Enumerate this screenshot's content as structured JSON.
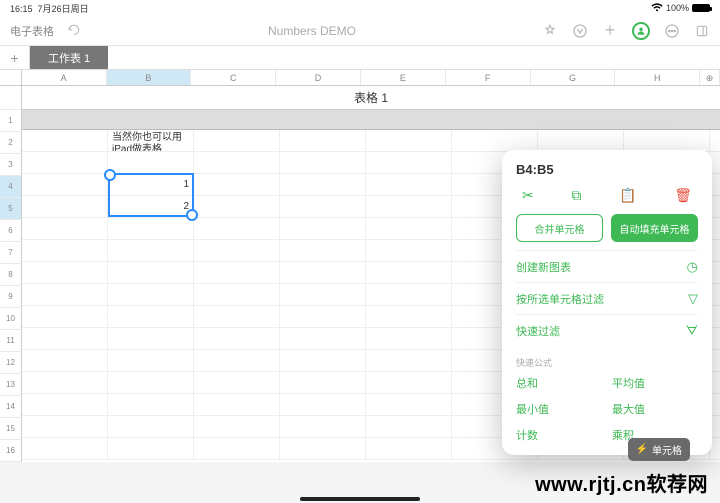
{
  "status": {
    "time": "16:15",
    "date": "7月26日周日",
    "battery": "100%"
  },
  "toolbar": {
    "back": "电子表格",
    "title": "Numbers DEMO"
  },
  "tabs": {
    "sheet1": "工作表 1"
  },
  "columns": [
    "A",
    "B",
    "C",
    "D",
    "E",
    "F",
    "G",
    "H"
  ],
  "table": {
    "title": "表格 1",
    "b2": "当然你也可以用\niPad做表格",
    "b4": "1",
    "b5": "2"
  },
  "popover": {
    "ref": "B4:B5",
    "merge": "合并单元格",
    "autofill": "自动填充单元格",
    "newchart": "创建新图表",
    "filtersel": "按所选单元格过滤",
    "quickfilter": "快速过滤",
    "section": "快速公式",
    "sum": "总和",
    "avg": "平均值",
    "min": "最小值",
    "max": "最大值",
    "count": "计数",
    "product": "乘积"
  },
  "cellpill": "单元格",
  "watermark": "www.rjtj.cn软荐网"
}
